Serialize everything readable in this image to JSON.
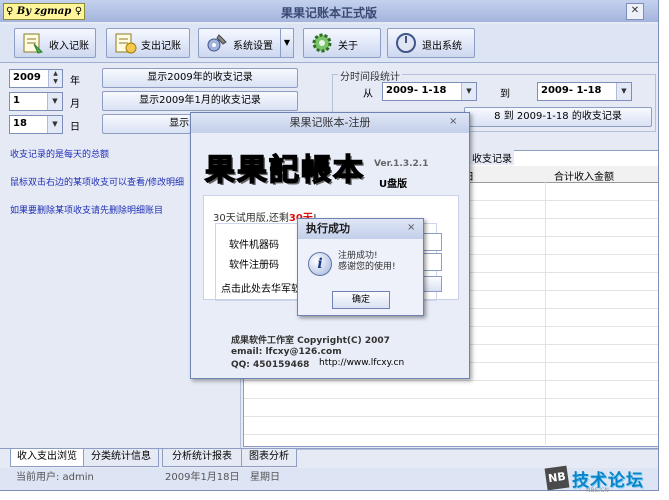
{
  "window": {
    "author_badge": "♀ By zgmap ♀",
    "title": "果果记账本正式版",
    "close_glyph": "✕"
  },
  "toolbar": {
    "income": "收入记账",
    "expense": "支出记账",
    "settings": "系统设置",
    "dropdown_glyph": "▼",
    "about": "关于",
    "exit": "退出系统"
  },
  "date_panel": {
    "year_value": "2009",
    "year_unit": "年",
    "month_value": "1",
    "month_unit": "月",
    "day_value": "18",
    "day_unit": "日",
    "show_year_btn": "显示2009年的收支记录",
    "show_month_btn": "显示2009年1月的收支记录",
    "show_day_btn": "显示2009年1",
    "spin_up": "▲",
    "spin_down": "▼",
    "combo_arrow": "▼"
  },
  "range_panel": {
    "group_label": "分时间段统计",
    "from_label": "从",
    "from_value": "2009-  1-18",
    "to_label": "到",
    "to_value": "2009-  1-18",
    "show_btn": "8 到 2009-1-18 的收支记录"
  },
  "tips": {
    "line1": "收支记录的是每天的总额",
    "line2": "鼠标双击右边的某项收支可以查看/修改明细",
    "line3": "如果要删除某项收支请先删除明细账目"
  },
  "grid": {
    "caption": "收支记录",
    "col1": "日",
    "col2": "合计收入金额"
  },
  "tabs": {
    "tab1": "收入支出浏览",
    "tab2": "分类统计信息",
    "tab3": "分析统计报表",
    "tab4": "图表分析"
  },
  "status": {
    "user": "当前用户: admin",
    "date": "2009年1月18日",
    "weekday": "星期日"
  },
  "register_dialog": {
    "title": "果果记账本-注册",
    "close_glyph": "×",
    "logo": "果果記帳本",
    "version": "Ver.1.3.2.1",
    "edition": "U盘版",
    "trial_prefix": "30天试用版,还剩",
    "trial_days": "30天",
    "trial_suffix": "!",
    "machine_code_label": "软件机器码",
    "register_code_label": "软件注册码",
    "buy_link": "点击此处去华军软",
    "studio": "成果软件工作室  Copyright(C) 2007",
    "email": "email: lfcxy@126.com",
    "qq": "QQ: 450159468",
    "website": "http://www.lfcxy.cn"
  },
  "success_dialog": {
    "title": "执行成功",
    "close_glyph": "×",
    "icon_glyph": "i",
    "message_line1": "注册成功!",
    "message_line2": "感谢您的使用!",
    "ok_button": "确定"
  },
  "watermark": {
    "logo_letters": "NB",
    "text": "技术论坛",
    "small": "NBS.CN"
  },
  "colors": {
    "accent": "#1f2fb5",
    "trial_highlight": "#e01010",
    "window_bg": "#e6eaf5",
    "watermark": "#0a84c9"
  }
}
